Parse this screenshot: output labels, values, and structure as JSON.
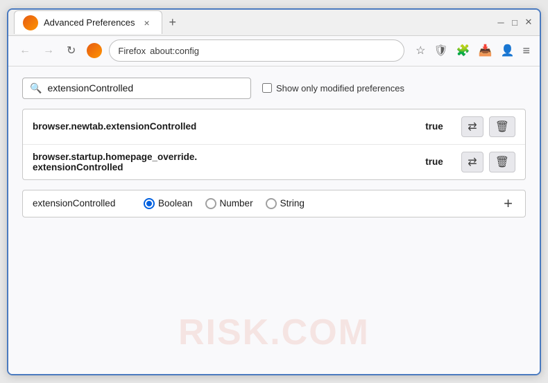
{
  "window": {
    "title": "Advanced Preferences",
    "new_tab_btn": "+",
    "tab_close_label": "×",
    "win_minimize": "─",
    "win_restore": "□",
    "win_close": "✕"
  },
  "navbar": {
    "back_btn": "←",
    "forward_btn": "→",
    "reload_btn": "↻",
    "browser_name": "Firefox",
    "address": "about:config",
    "star_icon": "☆",
    "shield_icon": "🛡",
    "extension_icon": "🧩",
    "menu_icon": "≡"
  },
  "search": {
    "placeholder": "extensionControlled",
    "value": "extensionControlled",
    "checkbox_label": "Show only modified preferences"
  },
  "results": [
    {
      "name": "browser.newtab.extensionControlled",
      "value": "true"
    },
    {
      "name": "browser.startup.homepage_override.\nextensionControlled",
      "name_line1": "browser.startup.homepage_override.",
      "name_line2": "extensionControlled",
      "value": "true",
      "multiline": true
    }
  ],
  "add_pref": {
    "name": "extensionControlled",
    "types": [
      {
        "id": "boolean",
        "label": "Boolean",
        "selected": true
      },
      {
        "id": "number",
        "label": "Number",
        "selected": false
      },
      {
        "id": "string",
        "label": "String",
        "selected": false
      }
    ],
    "add_btn_label": "+"
  },
  "watermark": "RISK.COM"
}
